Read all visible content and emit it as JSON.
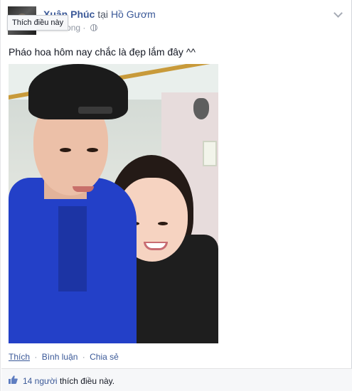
{
  "post": {
    "author_name": "Xuân Phúc",
    "at_word": "tại",
    "place_name": "Hồ Gươm",
    "timestamp": "Vừa xong",
    "meta_separator": "·",
    "privacy_icon": "globe-icon",
    "tooltip": "Thích điều này",
    "text": "Pháo hoa hôm nay chắc là đẹp lắm đây ^^",
    "menu_icon": "chevron-down-icon"
  },
  "actions": {
    "like": "Thích",
    "comment": "Bình luận",
    "share": "Chia sẻ",
    "separator": "·"
  },
  "likes": {
    "icon": "thumbs-up-icon",
    "count_text": "14 người",
    "rest_text": "thích điều này."
  },
  "colors": {
    "link": "#3b5998",
    "meta": "#9197a3",
    "bar_bg": "#f6f7f9"
  }
}
